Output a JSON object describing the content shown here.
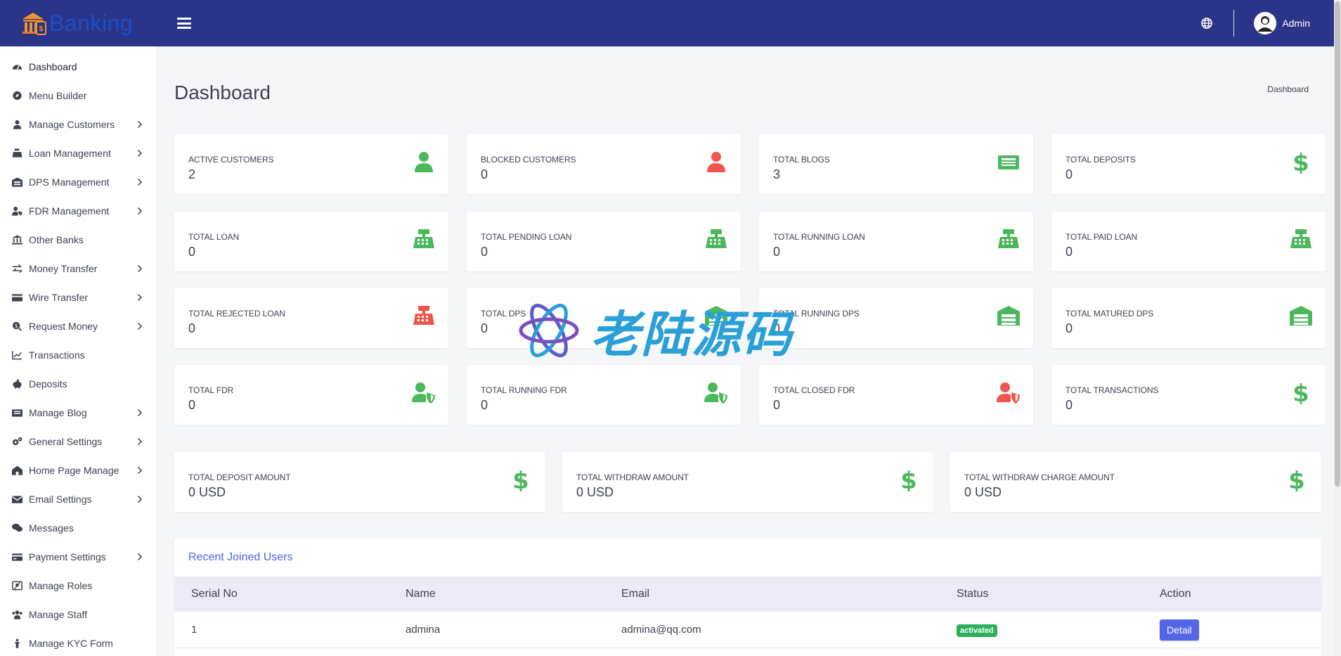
{
  "brand": {
    "name": "Banking"
  },
  "header": {
    "user_name": "Admin"
  },
  "sidebar": {
    "items": [
      {
        "label": "Dashboard",
        "icon": "dashboard-icon",
        "has_children": false
      },
      {
        "label": "Menu Builder",
        "icon": "compass-icon",
        "has_children": false
      },
      {
        "label": "Manage Customers",
        "icon": "user-icon",
        "has_children": true
      },
      {
        "label": "Loan Management",
        "icon": "cash-register-icon",
        "has_children": true
      },
      {
        "label": "DPS Management",
        "icon": "warehouse-icon",
        "has_children": true
      },
      {
        "label": "FDR Management",
        "icon": "user-shield-icon",
        "has_children": true
      },
      {
        "label": "Other Banks",
        "icon": "bank-icon",
        "has_children": false
      },
      {
        "label": "Money Transfer",
        "icon": "exchange-icon",
        "has_children": true
      },
      {
        "label": "Wire Transfer",
        "icon": "credit-card-icon",
        "has_children": true
      },
      {
        "label": "Request Money",
        "icon": "search-dollar-icon",
        "has_children": true
      },
      {
        "label": "Transactions",
        "icon": "chart-line-icon",
        "has_children": false
      },
      {
        "label": "Deposits",
        "icon": "piggy-bank-icon",
        "has_children": false
      },
      {
        "label": "Manage Blog",
        "icon": "newspaper-icon",
        "has_children": true
      },
      {
        "label": "General Settings",
        "icon": "cogs-icon",
        "has_children": true
      },
      {
        "label": "Home Page Manage",
        "icon": "house-icon",
        "has_children": true
      },
      {
        "label": "Email Settings",
        "icon": "envelope-icon",
        "has_children": true
      },
      {
        "label": "Messages",
        "icon": "comments-icon",
        "has_children": false
      },
      {
        "label": "Payment Settings",
        "icon": "money-card-icon",
        "has_children": true
      },
      {
        "label": "Manage Roles",
        "icon": "roles-icon",
        "has_children": false
      },
      {
        "label": "Manage Staff",
        "icon": "users-icon",
        "has_children": false
      },
      {
        "label": "Manage KYC Form",
        "icon": "kyc-icon",
        "has_children": false
      }
    ]
  },
  "page": {
    "title": "Dashboard",
    "breadcrumb": "Dashboard"
  },
  "stats": [
    {
      "label": "ACTIVE CUSTOMERS",
      "value": "2",
      "icon": "user-icon",
      "color": "#4cb85c"
    },
    {
      "label": "BLOCKED CUSTOMERS",
      "value": "0",
      "icon": "user-icon",
      "color": "#f0544f"
    },
    {
      "label": "TOTAL BLOGS",
      "value": "3",
      "icon": "newspaper-icon",
      "color": "#4cb85c"
    },
    {
      "label": "TOTAL DEPOSITS",
      "value": "0",
      "icon": "dollar-icon",
      "color": "#4cb85c"
    },
    {
      "label": "TOTAL LOAN",
      "value": "0",
      "icon": "cash-register-icon",
      "color": "#4cb85c"
    },
    {
      "label": "TOTAL PENDING LOAN",
      "value": "0",
      "icon": "cash-register-icon",
      "color": "#4cb85c"
    },
    {
      "label": "TOTAL RUNNING LOAN",
      "value": "0",
      "icon": "cash-register-icon",
      "color": "#4cb85c"
    },
    {
      "label": "TOTAL PAID LOAN",
      "value": "0",
      "icon": "cash-register-icon",
      "color": "#4cb85c"
    },
    {
      "label": "TOTAL REJECTED LOAN",
      "value": "0",
      "icon": "cash-register-icon",
      "color": "#f0544f"
    },
    {
      "label": "TOTAL DPS",
      "value": "0",
      "icon": "warehouse-icon",
      "color": "#4cb85c"
    },
    {
      "label": "TOTAL RUNNING DPS",
      "value": "0",
      "icon": "warehouse-icon",
      "color": "#4cb85c"
    },
    {
      "label": "TOTAL MATURED DPS",
      "value": "0",
      "icon": "warehouse-icon",
      "color": "#4cb85c"
    },
    {
      "label": "TOTAL FDR",
      "value": "0",
      "icon": "user-shield-icon",
      "color": "#4cb85c"
    },
    {
      "label": "TOTAL RUNNING FDR",
      "value": "0",
      "icon": "user-shield-icon",
      "color": "#4cb85c"
    },
    {
      "label": "TOTAL CLOSED FDR",
      "value": "0",
      "icon": "user-shield-icon",
      "color": "#f0544f"
    },
    {
      "label": "TOTAL TRANSACTIONS",
      "value": "0",
      "icon": "dollar-icon",
      "color": "#4cb85c"
    }
  ],
  "amounts": [
    {
      "label": "TOTAL DEPOSIT AMOUNT",
      "value": "0 USD",
      "icon": "dollar-icon",
      "color": "#4cb85c"
    },
    {
      "label": "TOTAL WITHDRAW AMOUNT",
      "value": "0 USD",
      "icon": "dollar-icon",
      "color": "#4cb85c"
    },
    {
      "label": "TOTAL WITHDRAW CHARGE AMOUNT",
      "value": "0 USD",
      "icon": "dollar-icon",
      "color": "#4cb85c"
    }
  ],
  "recent_users": {
    "title": "Recent Joined Users",
    "columns": [
      "Serial No",
      "Name",
      "Email",
      "Status",
      "Action"
    ],
    "rows": [
      {
        "serial": "1",
        "name": "admina",
        "email": "admina@qq.com",
        "status": "activated",
        "action": "Detail"
      }
    ]
  },
  "watermark": {
    "text": "老陆源码"
  },
  "colors": {
    "header_bg": "#2a3589",
    "accent": "#4e64ea",
    "green": "#4cb85c",
    "red": "#f0544f"
  }
}
